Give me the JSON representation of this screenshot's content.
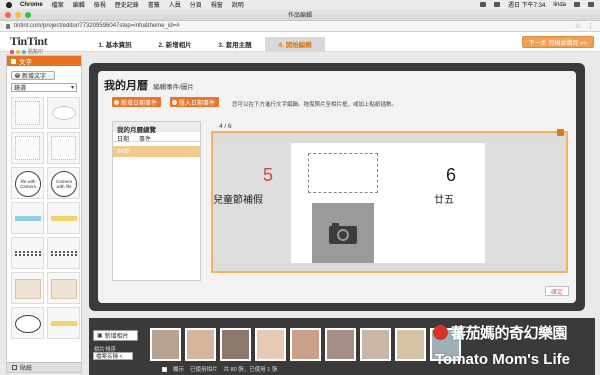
{
  "menubar": {
    "app": "Chrome",
    "items": [
      "檔案",
      "編輯",
      "檢視",
      "歷史記錄",
      "書籤",
      "人員",
      "分頁",
      "視窗",
      "說明"
    ],
    "clock": "週日 下午7:34",
    "user": "linda"
  },
  "browser": {
    "window_title": "作品編輯",
    "url": "tintint.com/project/editor/773209596047step=info&theme_id=#"
  },
  "header": {
    "logo": "TinTint",
    "logo_sub": "點點印",
    "steps": [
      "1. 基本資訊",
      "2. 新增相片",
      "3. 套用主題",
      "4. 開始編輯"
    ],
    "active_step": 3,
    "next_button": "下一步 完稿並購買 >>"
  },
  "sidebar": {
    "title": "文字",
    "add_text": "新增文字",
    "style_select": "鏡選",
    "tiles": [
      {
        "kind": "dots",
        "text": ""
      },
      {
        "kind": "bubble",
        "text": ""
      },
      {
        "kind": "dots",
        "text": ""
      },
      {
        "kind": "dots",
        "text": ""
      },
      {
        "kind": "circle-text",
        "text": "life with Camera"
      },
      {
        "kind": "circle-text",
        "text": "Camera with life"
      },
      {
        "kind": "tape",
        "text": ""
      },
      {
        "kind": "tape",
        "text": ""
      },
      {
        "kind": "ornament",
        "text": ""
      },
      {
        "kind": "ornament",
        "text": ""
      },
      {
        "kind": "paper",
        "text": ""
      },
      {
        "kind": "paper",
        "text": ""
      },
      {
        "kind": "oval",
        "text": ""
      },
      {
        "kind": "tape",
        "text": ""
      }
    ],
    "footer": "貼紙"
  },
  "editor": {
    "title": "我的月曆",
    "subtitle": "編輯事件/圖片",
    "add_date_event": "新增日期事件",
    "import_date_event": "匯入日期事件",
    "hint": "您可以在下方進行文字編輯。拖曳照片至相片框，或加上貼紙插數。",
    "events_title": "我的月曆總覽",
    "col_date": "日期",
    "col_event": "事件",
    "event_rows": [
      {
        "date": "0406",
        "event": ""
      }
    ],
    "page_counter": "4 / 6",
    "left_day": "5",
    "left_text": "兒童節補假",
    "right_day": "6",
    "right_text": "廿五",
    "confirm": "確定"
  },
  "photo_strip": {
    "add_photo": "新增相片",
    "sort_label": "相片排序",
    "sort_value": "檔案名稱 <",
    "status_show": "顯示",
    "status_used": "已使用相片",
    "status_count": "共 80 張，已使用 1 張",
    "thumb_colors": [
      "#b9a28f",
      "#d7b49c",
      "#8c7a6e",
      "#e7c9b6",
      "#caa089",
      "#a78e86",
      "#c9b6a6",
      "#d5c3a4",
      "#9db0b6",
      "#8f7a72",
      "#b7a4a0",
      "#c7a995",
      "#bca08f",
      "#a89078"
    ]
  },
  "watermark": {
    "cn": "蕃茄媽的奇幻樂園",
    "en": "Tomato Mom's Life"
  },
  "colors": {
    "accent": "#e8731f",
    "active_step_text": "#e07a12",
    "frame_border": "#f5b35a",
    "red_number": "#c94a3a"
  }
}
